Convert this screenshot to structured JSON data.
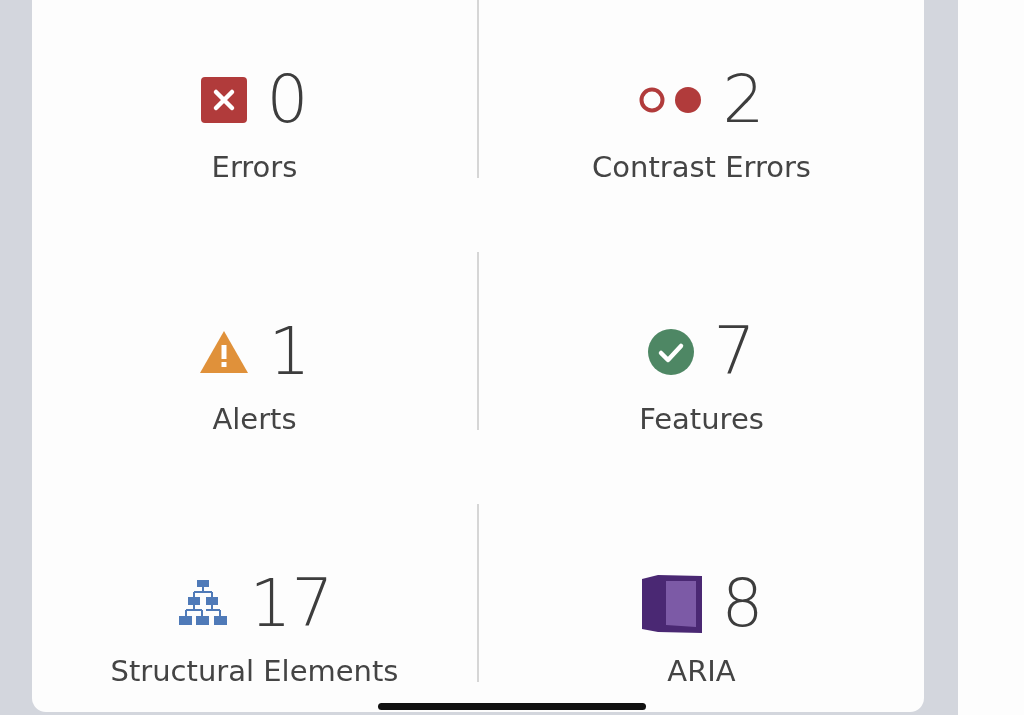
{
  "stats": [
    {
      "kind": "error",
      "count": "0",
      "label": "Errors"
    },
    {
      "kind": "contrast",
      "count": "2",
      "label": "Contrast Errors"
    },
    {
      "kind": "alert",
      "count": "1",
      "label": "Alerts"
    },
    {
      "kind": "feature",
      "count": "7",
      "label": "Features"
    },
    {
      "kind": "structure",
      "count": "17",
      "label": "Structural Elements"
    },
    {
      "kind": "aria",
      "count": "8",
      "label": "ARIA"
    }
  ]
}
